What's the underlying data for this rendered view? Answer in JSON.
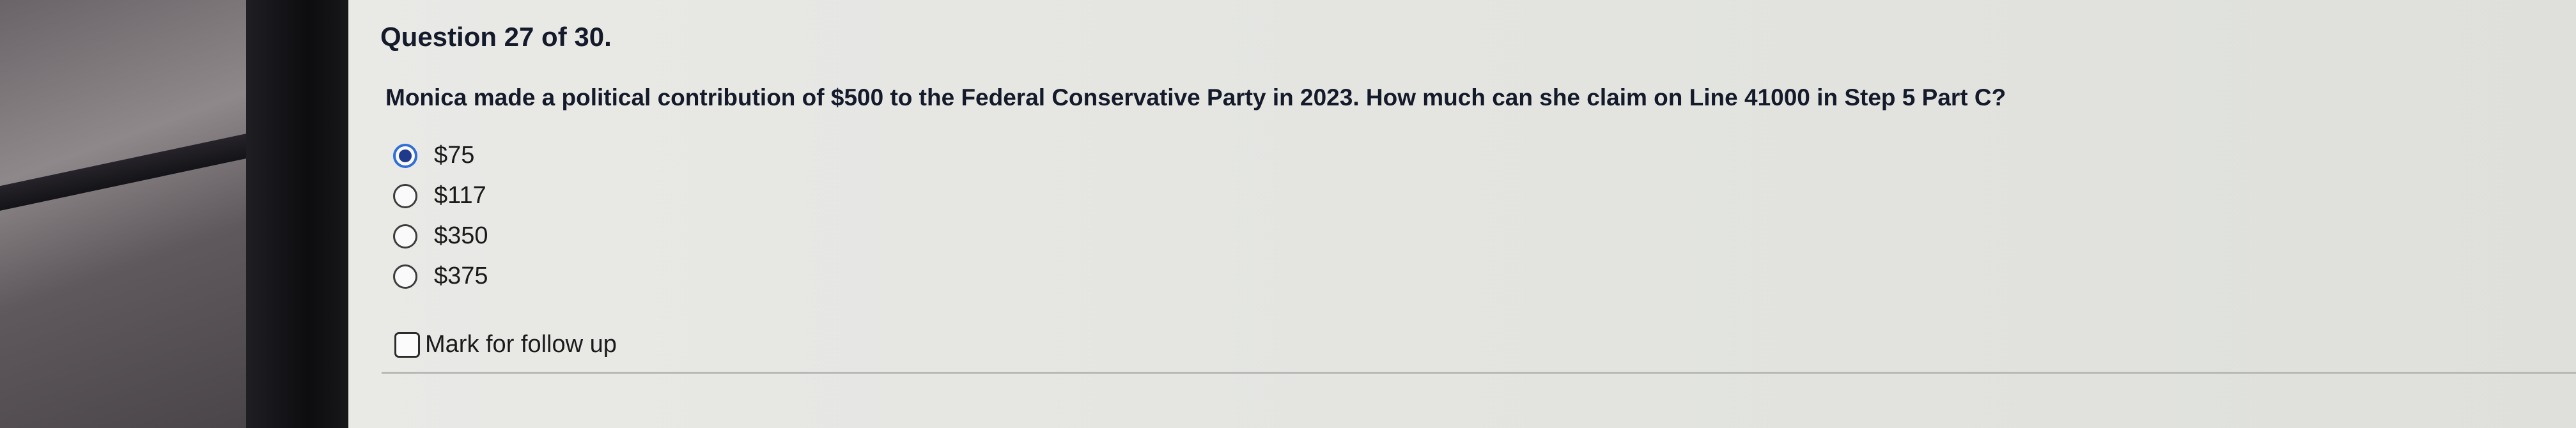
{
  "question": {
    "number_label": "Question 27 of 30.",
    "text": "Monica made a political contribution of $500 to the Federal Conservative Party in 2023. How much can she claim on Line 41000 in Step 5 Part C?"
  },
  "options": [
    {
      "label": "$75",
      "selected": true
    },
    {
      "label": "$117",
      "selected": false
    },
    {
      "label": "$350",
      "selected": false
    },
    {
      "label": "$375",
      "selected": false
    }
  ],
  "follow_up": {
    "label": "Mark for follow up",
    "checked": false
  },
  "colors": {
    "selected_ring": "#2f6fd6",
    "selected_dot": "#1f3a8a",
    "text": "#151a2b"
  }
}
